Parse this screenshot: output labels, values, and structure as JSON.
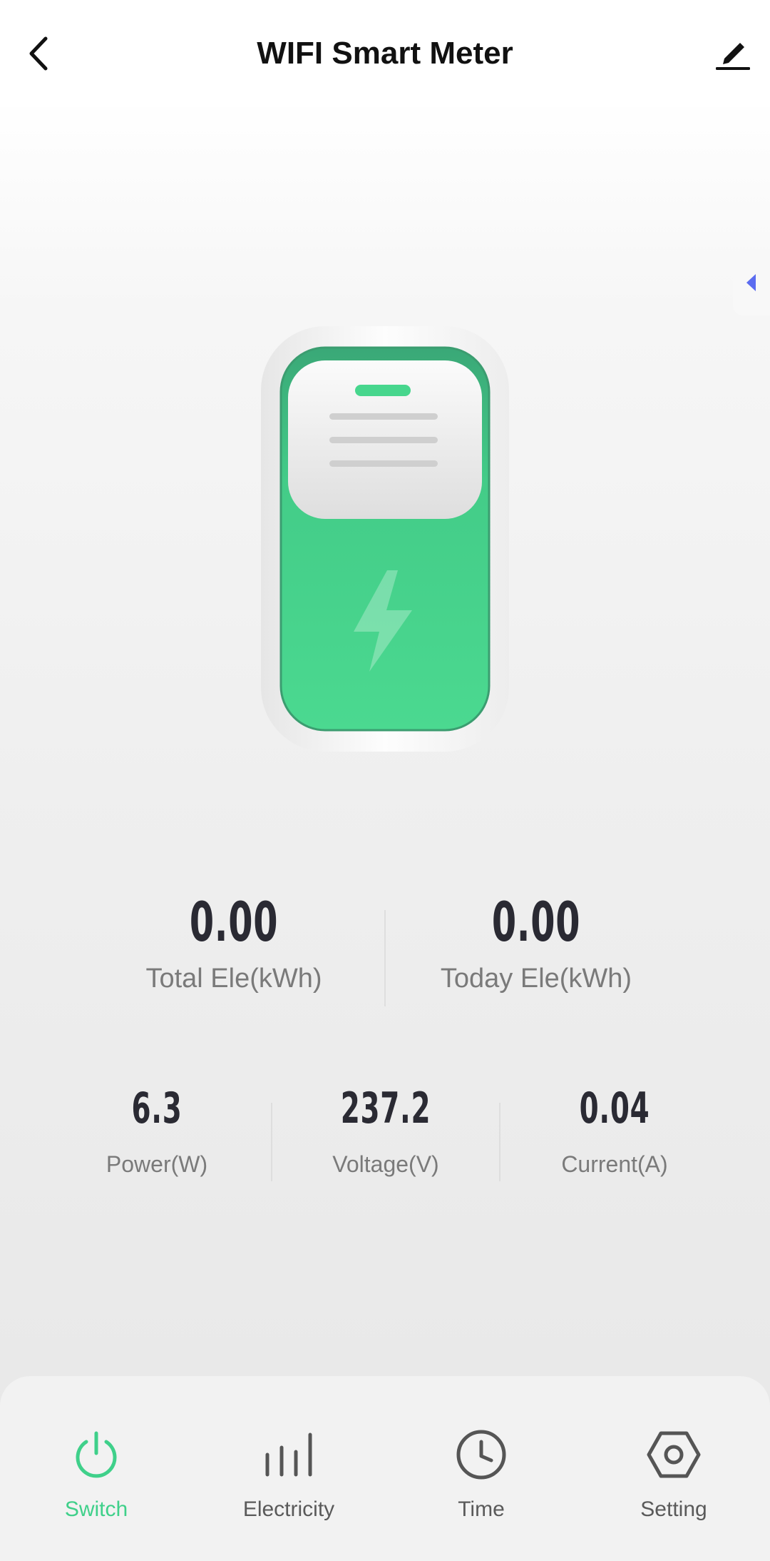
{
  "header": {
    "title": "WIFI Smart Meter",
    "back_icon": "chevron-left-icon",
    "edit_icon": "pencil-icon"
  },
  "side_tab": {
    "icon": "caret-left-icon",
    "color": "#5b6cf0"
  },
  "device": {
    "icon": "smart-plug-illustration",
    "accent_color": "#44d48c",
    "state": "on"
  },
  "energy": [
    {
      "value": "0.00",
      "label": "Total Ele(kWh)"
    },
    {
      "value": "0.00",
      "label": "Today Ele(kWh)"
    }
  ],
  "readings": [
    {
      "value": "6.3",
      "label": "Power(W)"
    },
    {
      "value": "237.2",
      "label": "Voltage(V)"
    },
    {
      "value": "0.04",
      "label": "Current(A)"
    }
  ],
  "nav": {
    "active": "Switch",
    "active_color": "#3fd08a",
    "items": [
      {
        "label": "Switch",
        "icon": "power-icon"
      },
      {
        "label": "Electricity",
        "icon": "bar-chart-icon"
      },
      {
        "label": "Time",
        "icon": "clock-icon"
      },
      {
        "label": "Setting",
        "icon": "settings-hex-icon"
      }
    ]
  }
}
